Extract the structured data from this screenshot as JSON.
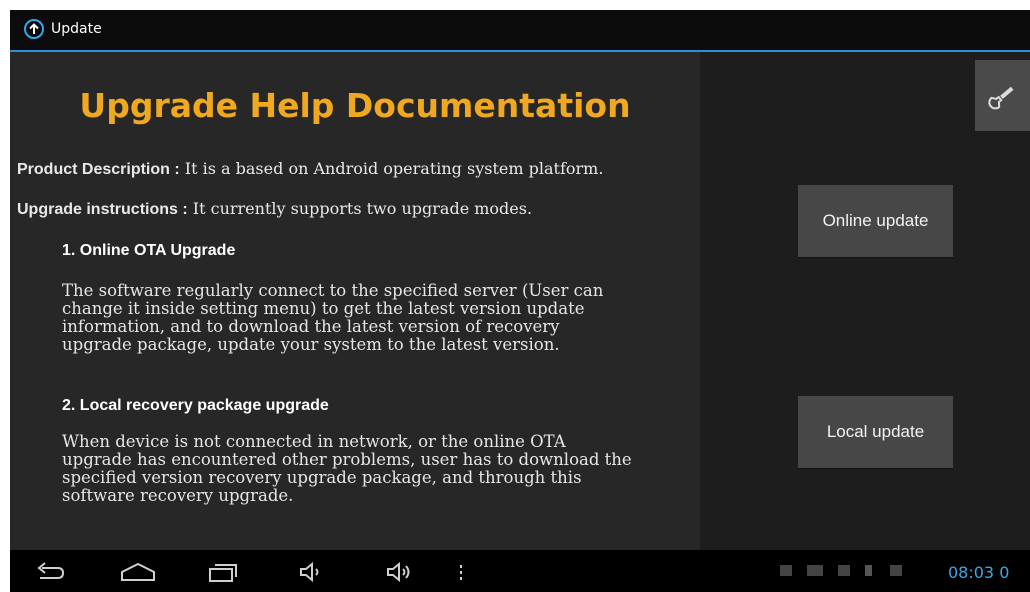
{
  "app": {
    "title": "Update"
  },
  "doc": {
    "title": "Upgrade Help Documentation",
    "product_label": "Product Description :",
    "product_text": " It is a based on Android operating system platform.",
    "instructions_label": "Upgrade instructions :",
    "instructions_text": " It currently supports two upgrade modes.",
    "section1_heading": "1. Online OTA Upgrade",
    "section1_text": "The software regularly connect to the specified server (User can\nchange it inside setting menu) to get the latest version update\ninformation, and to download the latest version of recovery\nupgrade package, update your system to the latest version.",
    "section2_heading": "2. Local recovery package upgrade",
    "section2_text": "When device is not connected in network, or the online OTA\nupgrade has encountered other problems, user has to download the\nspecified version recovery upgrade package, and through this\nsoftware recovery upgrade."
  },
  "buttons": {
    "online_update": "Online update",
    "local_update": "Local update",
    "settings_icon": "wrench-icon"
  },
  "status": {
    "time": "08:03",
    "time_suffix": "0"
  },
  "icons": {
    "app": "arrow-up-circle-icon",
    "back": "back-icon",
    "home": "home-icon",
    "recents": "recents-icon",
    "vol_down": "volume-down-icon",
    "vol_up": "volume-up-icon",
    "menu": "overflow-menu-icon"
  },
  "colors": {
    "title": "#f0a820",
    "accent": "#2f8fd6",
    "clock": "#3aa8ea"
  }
}
